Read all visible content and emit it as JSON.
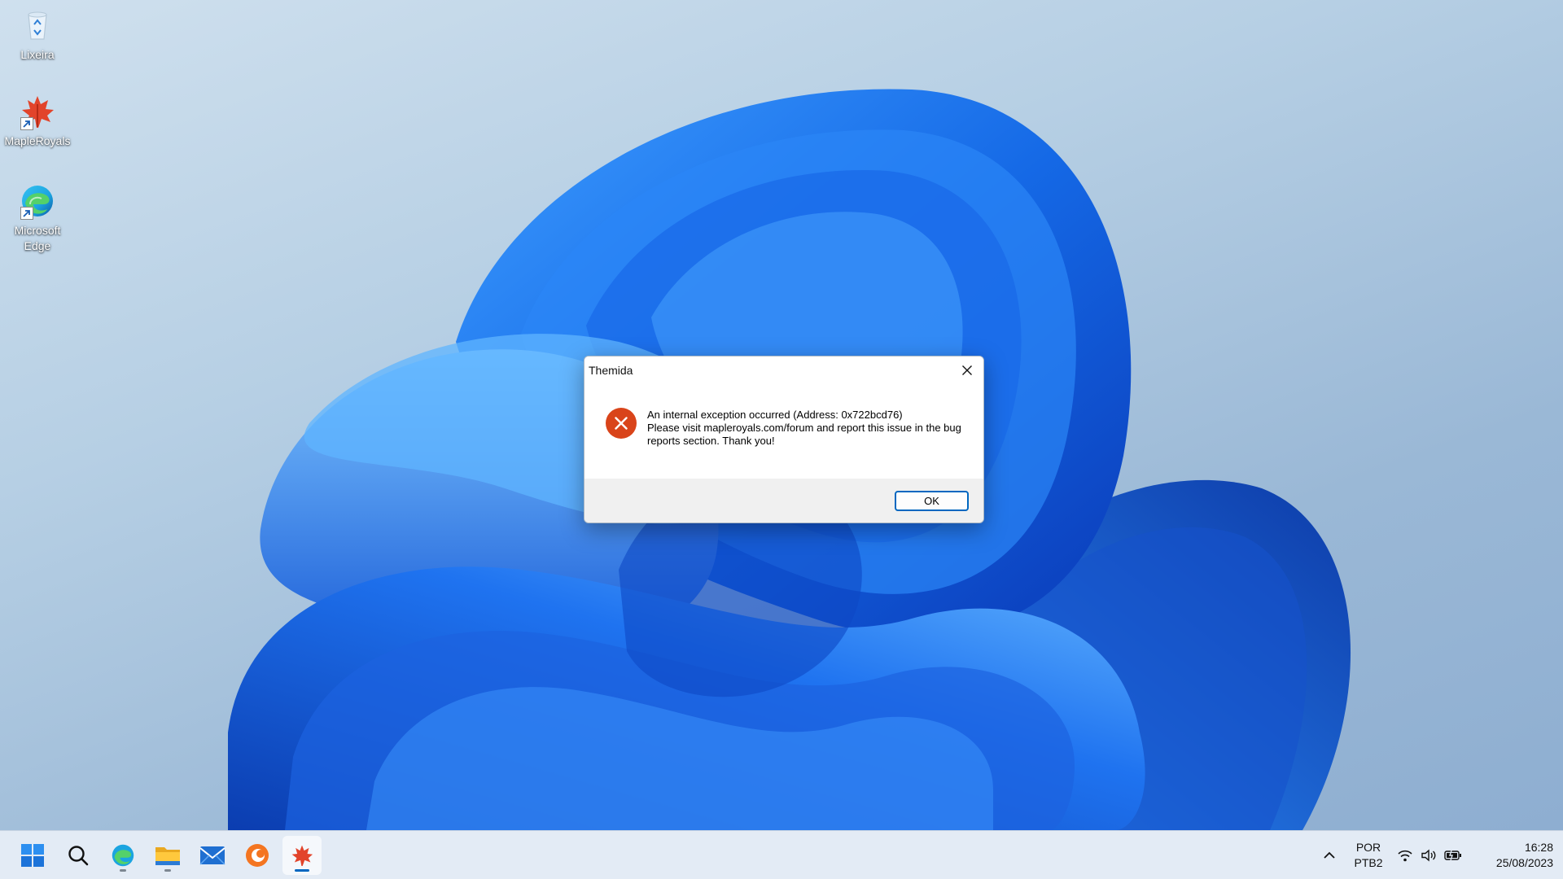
{
  "desktop": {
    "icons": [
      {
        "label": "Lixeira",
        "icon": "recycle-bin-icon"
      },
      {
        "label": "MapleRoyals",
        "icon": "maple-leaf-icon"
      },
      {
        "label": "Microsoft Edge",
        "icon": "edge-icon"
      }
    ]
  },
  "dialog": {
    "title": "Themida",
    "message_lines": [
      "An internal exception occurred (Address: 0x722bcd76)",
      "Please visit mapleroyals.com/forum and report this issue in the bug",
      "reports section. Thank you!"
    ],
    "ok_label": "OK",
    "icon": "error-icon",
    "close_icon": "close-icon"
  },
  "taskbar": {
    "items": [
      {
        "icon": "windows-start-icon"
      },
      {
        "icon": "search-icon"
      },
      {
        "icon": "edge-icon"
      },
      {
        "icon": "file-explorer-icon"
      },
      {
        "icon": "mail-icon"
      },
      {
        "icon": "crunchyroll-icon"
      },
      {
        "icon": "maple-leaf-icon"
      }
    ],
    "tray": {
      "language": "POR",
      "layout": "PTB2",
      "time": "16:28",
      "date": "25/08/2023"
    }
  },
  "colors": {
    "accent": "#0067c0",
    "error": "#d9441a"
  }
}
